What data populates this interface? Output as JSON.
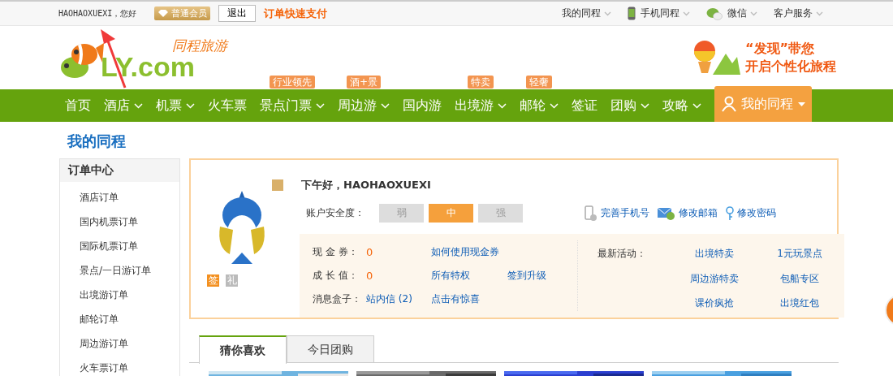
{
  "top_bar": {
    "greeting": "HAOHAOXUEXI，您好",
    "member_badge": "普通会员",
    "logout": "退出",
    "quick_pay": "订单快速支付",
    "right_links": [
      {
        "label": "我的同程",
        "kind": "plain"
      },
      {
        "label": "手机同程",
        "kind": "phone"
      },
      {
        "label": "微信",
        "kind": "wechat"
      },
      {
        "label": "客户服务",
        "kind": "plain"
      }
    ]
  },
  "header": {
    "logo_cn": "同程旅游",
    "logo_en": "LY.com",
    "slogan_1": "“发现”带您",
    "slogan_2": "开启个性化旅程"
  },
  "nav": {
    "items": [
      {
        "label": "首页",
        "dropdown": false
      },
      {
        "label": "酒店",
        "dropdown": true
      },
      {
        "label": "机票",
        "dropdown": true
      },
      {
        "label": "火车票",
        "dropdown": false
      },
      {
        "label": "景点门票",
        "dropdown": true,
        "tag": "行业领先"
      },
      {
        "label": "周边游",
        "dropdown": true,
        "tag": "酒+景"
      },
      {
        "label": "国内游",
        "dropdown": false
      },
      {
        "label": "出境游",
        "dropdown": true,
        "tag": "特卖"
      },
      {
        "label": "邮轮",
        "dropdown": true,
        "tag": "轻奢"
      },
      {
        "label": "签证",
        "dropdown": false
      },
      {
        "label": "团购",
        "dropdown": true
      },
      {
        "label": "攻略",
        "dropdown": true
      }
    ],
    "my_trip": "我的同程"
  },
  "page_title": "我的同程",
  "sidebar": {
    "heading": "订单中心",
    "items": [
      "酒店订单",
      "国内机票订单",
      "国际机票订单",
      "景点/一日游订单",
      "出境游订单",
      "邮轮订单",
      "周边游订单",
      "火车票订单"
    ]
  },
  "profile": {
    "greeting": "下午好，HAOHAOXUEXI",
    "security_label": "账户安全度：",
    "levels": [
      {
        "label": "弱",
        "selected": false
      },
      {
        "label": "中",
        "selected": true
      },
      {
        "label": "强",
        "selected": false
      }
    ],
    "account_links": [
      {
        "label": "完善手机号",
        "kind": "phone"
      },
      {
        "label": "修改邮箱",
        "kind": "mail"
      },
      {
        "label": "修改密码",
        "kind": "key"
      }
    ],
    "badges": [
      {
        "label": "签",
        "on": true
      },
      {
        "label": "礼",
        "on": false
      }
    ],
    "rows": [
      {
        "label": "现 金 券：",
        "value": "0",
        "links": [
          "如何使用现金券"
        ]
      },
      {
        "label": "成 长 值：",
        "value": "0",
        "links": [
          "所有特权",
          "签到升级"
        ]
      },
      {
        "label": "消息盒子：",
        "value": "站内信 (2)",
        "value_is_link": true,
        "links": [
          "点击有惊喜"
        ]
      }
    ],
    "activities_label": "最新活动：",
    "activities": [
      "出境特卖",
      "1元玩景点",
      "周边游特卖",
      "包船专区",
      "课价疯抢",
      "出境红包"
    ]
  },
  "tabs": [
    {
      "label": "猜你喜欢",
      "selected": true
    },
    {
      "label": "今日团购",
      "selected": false
    }
  ]
}
